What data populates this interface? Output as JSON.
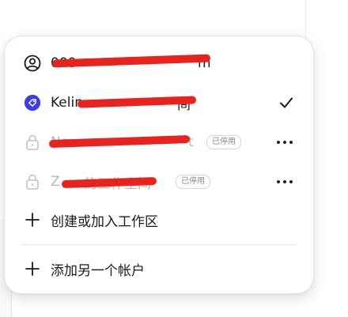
{
  "menu": {
    "accounts": [
      {
        "label": "000",
        "suffix": "m",
        "icon": "user-circle-icon",
        "redacted": true
      },
      {
        "label": "Kelin",
        "suffix": "间",
        "icon": "workspace-tag-icon",
        "selected": true,
        "redacted": true
      }
    ],
    "workspaces": [
      {
        "label": "Ne",
        "suffix": "t",
        "status": "已停用",
        "icon": "lock-icon",
        "redacted": true
      },
      {
        "label": "Z",
        "middle": "的工作空间",
        "status": "已停用",
        "icon": "lock-icon",
        "redacted": true
      }
    ],
    "create_join_label": "创建或加入工作区",
    "add_account_label": "添加另一个帐户"
  },
  "colors": {
    "accent": "#3b3bf0",
    "redaction": "#e8221c",
    "disabled_text": "#b8b8b8",
    "text": "#1a1a1a"
  }
}
